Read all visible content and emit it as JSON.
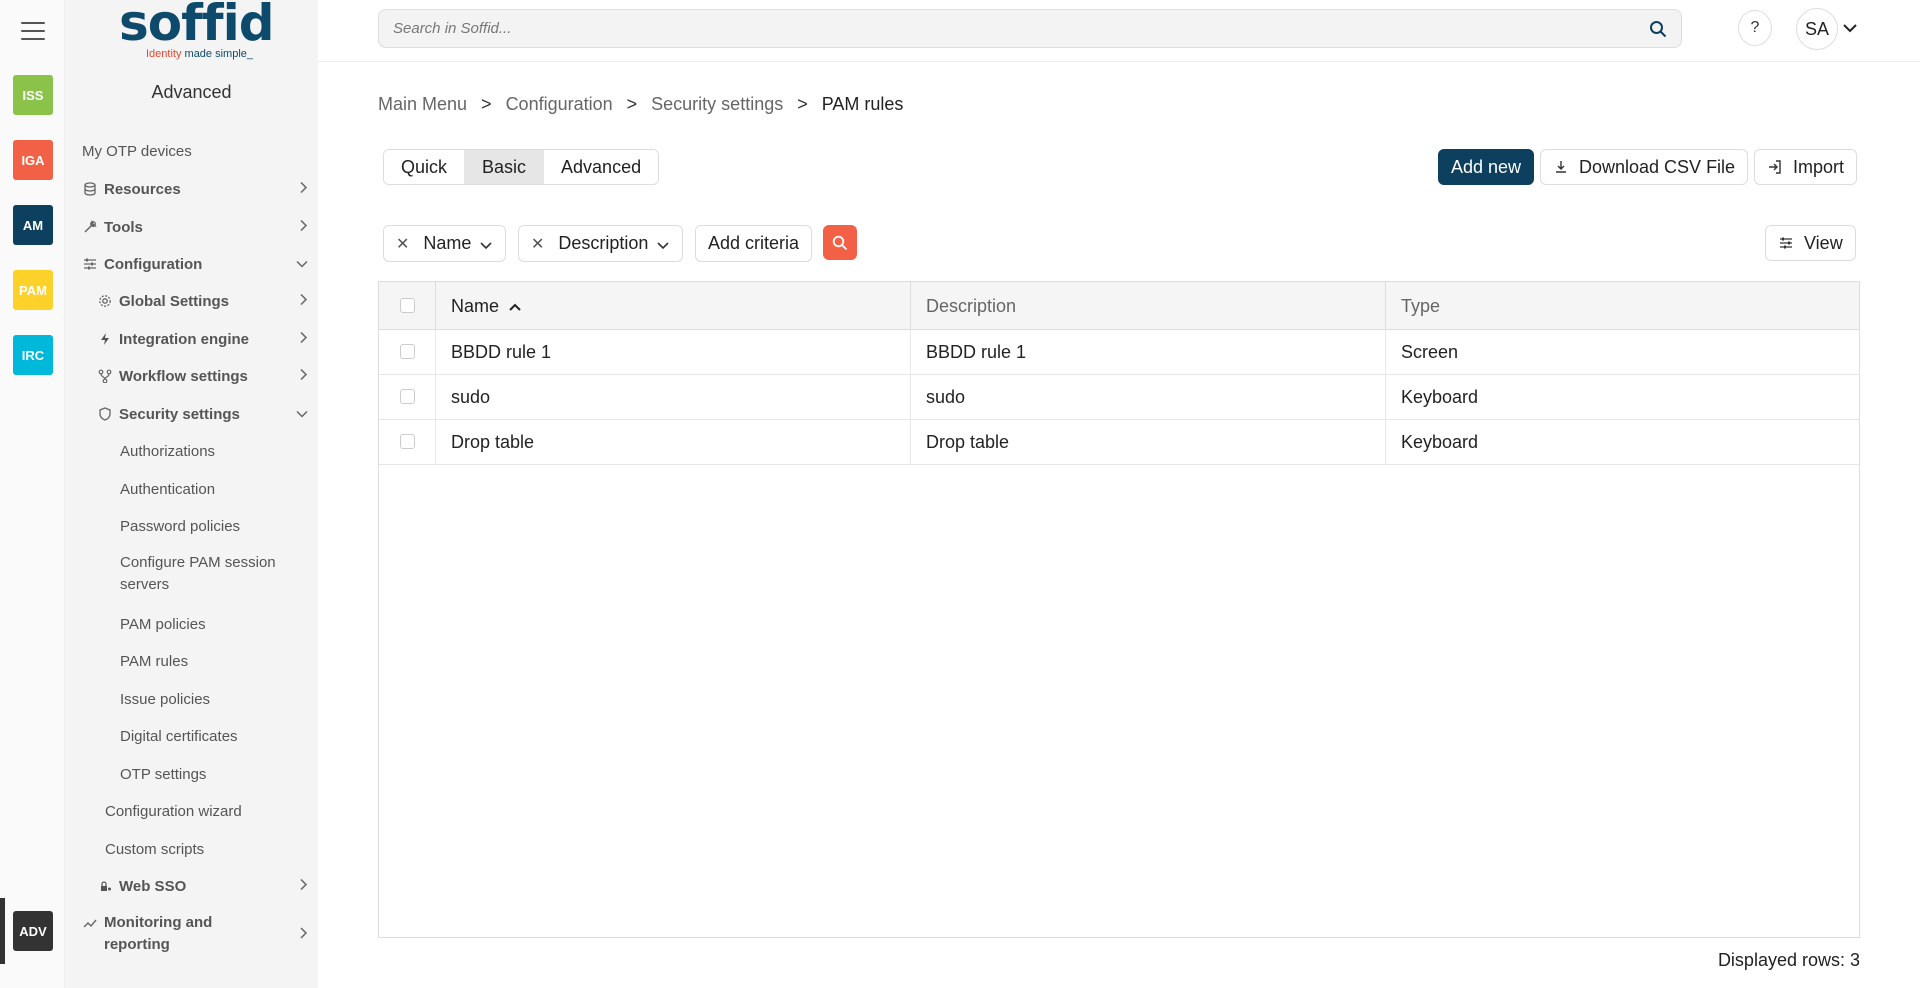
{
  "rail": {
    "apps": [
      {
        "label": "ISS",
        "color": "#8bc34a"
      },
      {
        "label": "IGA",
        "color": "#f26145"
      },
      {
        "label": "AM",
        "color": "#0d3f5e"
      },
      {
        "label": "PAM",
        "color": "#fcd12a"
      },
      {
        "label": "IRC",
        "color": "#00b8d9"
      },
      {
        "label": "ADV",
        "color": "#333333"
      }
    ]
  },
  "sidebar": {
    "logo": "soffid",
    "tagline_1": "Identity",
    "tagline_2": "made simple_",
    "title": "Advanced",
    "items": [
      {
        "label": "My OTP devices"
      },
      {
        "label": "Resources"
      },
      {
        "label": "Tools"
      },
      {
        "label": "Configuration"
      },
      {
        "label": "Global Settings"
      },
      {
        "label": "Integration engine"
      },
      {
        "label": "Workflow settings"
      },
      {
        "label": "Security settings"
      },
      {
        "label": "Authorizations"
      },
      {
        "label": "Authentication"
      },
      {
        "label": "Password policies"
      },
      {
        "label": "Configure PAM session servers"
      },
      {
        "label": "PAM policies"
      },
      {
        "label": "PAM rules"
      },
      {
        "label": "Issue policies"
      },
      {
        "label": "Digital certificates"
      },
      {
        "label": "OTP settings"
      },
      {
        "label": "Configuration wizard"
      },
      {
        "label": "Custom scripts"
      },
      {
        "label": "Web SSO"
      },
      {
        "label": "Monitoring and reporting"
      }
    ]
  },
  "topbar": {
    "search_placeholder": "Search in Soffid...",
    "help": "?",
    "user_initials": "SA"
  },
  "breadcrumb": {
    "items": [
      "Main Menu",
      "Configuration",
      "Security settings",
      "PAM rules"
    ],
    "separator": ">"
  },
  "tabs": [
    "Quick",
    "Basic",
    "Advanced"
  ],
  "actions": {
    "add_new": "Add new",
    "download_csv": "Download CSV File",
    "import": "Import",
    "view": "View"
  },
  "filters": {
    "name": "Name",
    "description": "Description",
    "add_criteria": "Add criteria"
  },
  "table": {
    "columns": [
      "Name",
      "Description",
      "Type"
    ],
    "rows": [
      {
        "name": "BBDD rule 1",
        "description": "BBDD rule 1",
        "type": "Screen"
      },
      {
        "name": "sudo",
        "description": "sudo",
        "type": "Keyboard"
      },
      {
        "name": "Drop table",
        "description": "Drop table",
        "type": "Keyboard"
      }
    ]
  },
  "footer": {
    "displayed_rows": "Displayed rows: 3"
  }
}
